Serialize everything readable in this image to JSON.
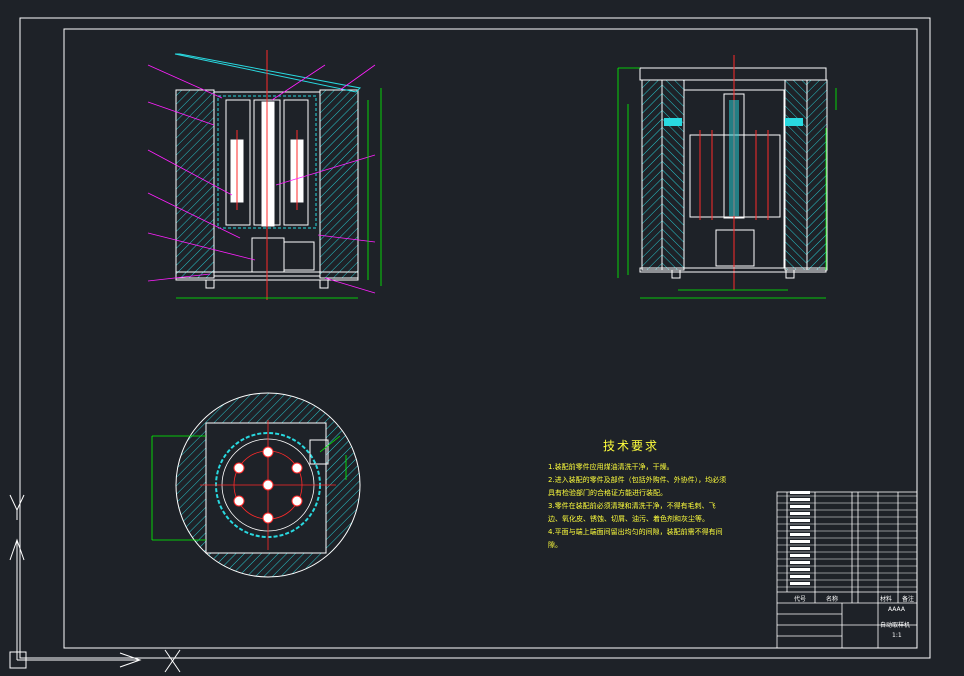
{
  "colors": {
    "background": "#1e2228",
    "border": "#ffffff",
    "hatch": "#29d9e0",
    "centerline": "#ff2a2a",
    "leader": "#ff20ff",
    "dimension": "#00ff00",
    "notes": "#ffff3c"
  },
  "technical_requirements": {
    "title": "技术要求",
    "items": [
      "1.装配前零件应用煤油清洗干净，干燥。",
      "2.进入装配的零件及部件（包括外购件、外协件），均必须具有检验部门的合格证方能进行装配。",
      "3.零件在装配前必须清理和清洗干净，不得有毛刺、飞边、氧化皮、锈蚀、切屑、油污、着色剂和灰尘等。",
      "4.平面与端上端面间留出均匀的间隙，装配前需不得有间隙。"
    ]
  },
  "title_block": {
    "drawing_name": "自动取样机",
    "labels": [
      "代号",
      "名称",
      "材料",
      "备注"
    ],
    "scale_text": "1:1",
    "code_text": "AAAA"
  },
  "ucs_icon": {
    "x_label": "X",
    "y_label": "Y"
  }
}
